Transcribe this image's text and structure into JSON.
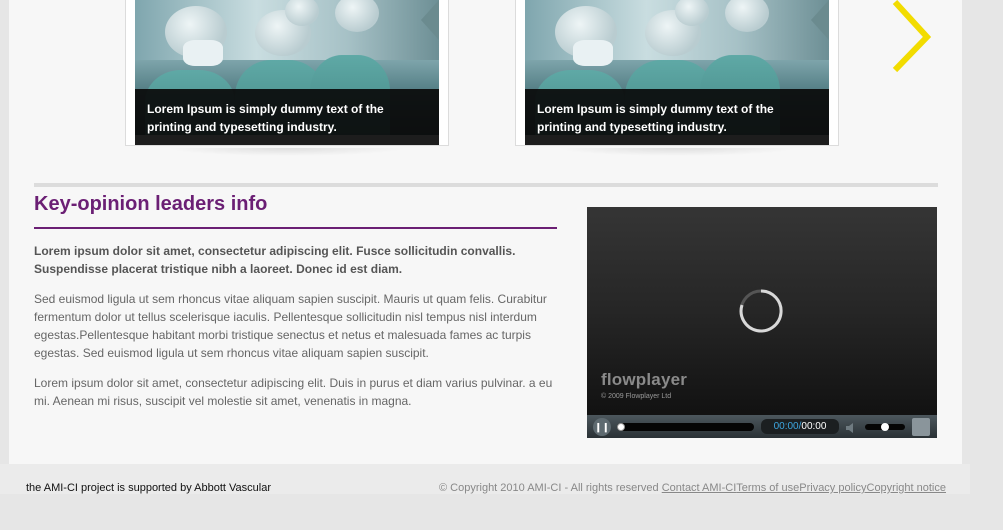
{
  "carousel": {
    "slides": [
      {
        "caption": "Lorem Ipsum is simply dummy text of the printing and typesetting industry."
      },
      {
        "caption": "Lorem Ipsum is simply dummy text of the printing and typesetting industry."
      }
    ],
    "next_icon": "chevron-right-icon",
    "accent_color": "#f2dc00"
  },
  "section": {
    "title": "Key-opinion leaders info",
    "lead": "Lorem ipsum dolor sit amet, consectetur adipiscing elit. Fusce sollicitudin convallis. Suspendisse placerat tristique nibh a laoreet. Donec id est diam.",
    "paragraph1": "Sed euismod ligula ut sem rhoncus vitae aliquam sapien suscipit. Mauris ut quam felis. Curabitur fermentum dolor ut tellus scelerisque iaculis. Pellentesque sollicitudin nisl tempus nisl interdum egestas.Pellentesque habitant morbi tristique senectus et netus et malesuada fames ac turpis egestas. Sed euismod ligula ut sem rhoncus vitae aliquam sapien suscipit.",
    "paragraph2": "Lorem ipsum dolor sit amet, consectetur adipiscing elit. Duis in purus et diam varius pulvinar. a eu mi. Aenean mi risus, suscipit vel molestie sit amet, venenatis in magna.",
    "title_color": "#6b1f74"
  },
  "player": {
    "brand": "flowplayer",
    "brand_copyright": "© 2009 Flowplayer Ltd",
    "time_current": "00:00",
    "time_separator": "/",
    "time_total": "00:00",
    "progress": 0,
    "volume": 0.5
  },
  "footer": {
    "left_text": "the AMI-CI project is supported by Abbott Vascular",
    "copyright": "© Copyright 2010 AMI-CI - All rights reserved",
    "links": [
      "Contact AMI-CI",
      "Terms of use",
      "Privacy policy",
      "Copyright notice"
    ]
  }
}
